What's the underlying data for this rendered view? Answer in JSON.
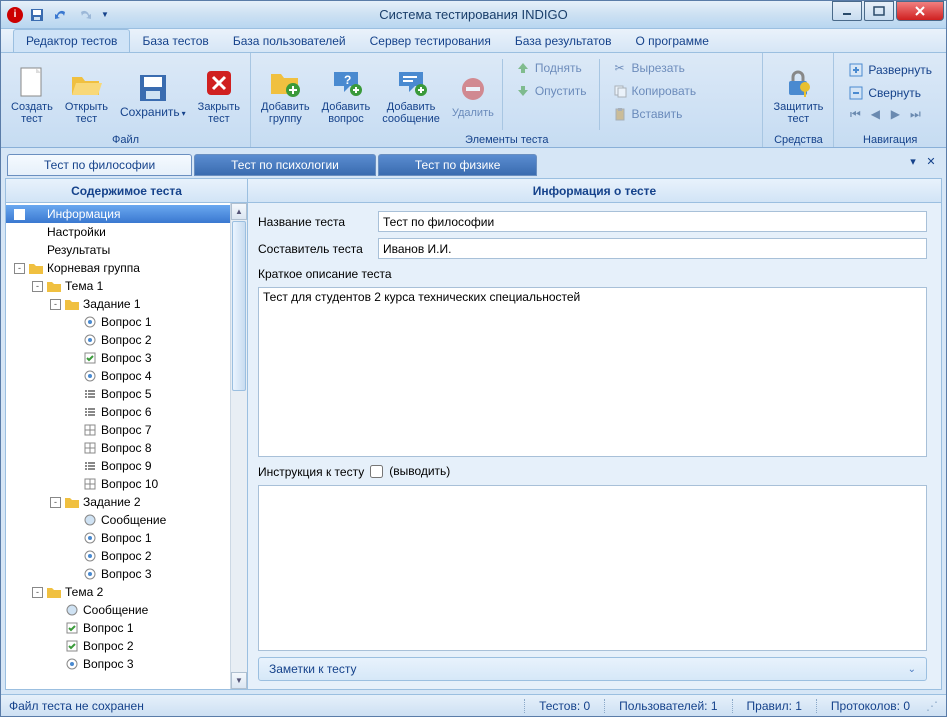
{
  "title": "Система тестирования INDIGO",
  "menu": {
    "items": [
      "Редактор тестов",
      "База тестов",
      "База пользователей",
      "Сервер тестирования",
      "База результатов",
      "О программе"
    ],
    "active": 0
  },
  "ribbon": {
    "file": {
      "label": "Файл",
      "create": "Создать\nтест",
      "open": "Открыть\nтест",
      "save": "Сохранить",
      "close": "Закрыть\nтест"
    },
    "elements": {
      "label": "Элементы теста",
      "addGroup": "Добавить\nгруппу",
      "addQuestion": "Добавить\nвопрос",
      "addMessage": "Добавить\nсообщение",
      "delete": "Удалить",
      "up": "Поднять",
      "down": "Опустить",
      "cut": "Вырезать",
      "copy": "Копировать",
      "paste": "Вставить"
    },
    "tools": {
      "label": "Средства",
      "protect": "Защитить\nтест"
    },
    "nav": {
      "label": "Навигация",
      "expand": "Развернуть",
      "collapse": "Свернуть"
    }
  },
  "docTabs": [
    "Тест по философии",
    "Тест по психологии",
    "Тест по физике"
  ],
  "leftTitle": "Содержимое теста",
  "rightTitle": "Информация о тесте",
  "tree": [
    {
      "lvl": 0,
      "pm": "",
      "icon": "info",
      "label": "Информация",
      "sel": true
    },
    {
      "lvl": 0,
      "pm": "",
      "icon": "info",
      "label": "Настройки"
    },
    {
      "lvl": 0,
      "pm": "",
      "icon": "info",
      "label": "Результаты"
    },
    {
      "lvl": 0,
      "pm": "-",
      "icon": "folder",
      "label": "Корневая группа"
    },
    {
      "lvl": 1,
      "pm": "-",
      "icon": "folder",
      "label": "Тема 1"
    },
    {
      "lvl": 2,
      "pm": "-",
      "icon": "folder",
      "label": "Задание 1"
    },
    {
      "lvl": 3,
      "pm": "",
      "icon": "radio",
      "label": "Вопрос 1"
    },
    {
      "lvl": 3,
      "pm": "",
      "icon": "radio",
      "label": "Вопрос 2"
    },
    {
      "lvl": 3,
      "pm": "",
      "icon": "check",
      "label": "Вопрос 3"
    },
    {
      "lvl": 3,
      "pm": "",
      "icon": "radio",
      "label": "Вопрос 4"
    },
    {
      "lvl": 3,
      "pm": "",
      "icon": "list",
      "label": "Вопрос 5"
    },
    {
      "lvl": 3,
      "pm": "",
      "icon": "list",
      "label": "Вопрос 6"
    },
    {
      "lvl": 3,
      "pm": "",
      "icon": "grid",
      "label": "Вопрос 7"
    },
    {
      "lvl": 3,
      "pm": "",
      "icon": "grid",
      "label": "Вопрос 8"
    },
    {
      "lvl": 3,
      "pm": "",
      "icon": "list",
      "label": "Вопрос 9"
    },
    {
      "lvl": 3,
      "pm": "",
      "icon": "grid",
      "label": "Вопрос 10"
    },
    {
      "lvl": 2,
      "pm": "-",
      "icon": "folder",
      "label": "Задание 2"
    },
    {
      "lvl": 3,
      "pm": "",
      "icon": "msg",
      "label": "Сообщение"
    },
    {
      "lvl": 3,
      "pm": "",
      "icon": "radio",
      "label": "Вопрос 1"
    },
    {
      "lvl": 3,
      "pm": "",
      "icon": "radio",
      "label": "Вопрос 2"
    },
    {
      "lvl": 3,
      "pm": "",
      "icon": "radio",
      "label": "Вопрос 3"
    },
    {
      "lvl": 1,
      "pm": "-",
      "icon": "folder",
      "label": "Тема 2"
    },
    {
      "lvl": 2,
      "pm": "",
      "icon": "msg",
      "label": "Сообщение"
    },
    {
      "lvl": 2,
      "pm": "",
      "icon": "check",
      "label": "Вопрос 1"
    },
    {
      "lvl": 2,
      "pm": "",
      "icon": "check",
      "label": "Вопрос 2"
    },
    {
      "lvl": 2,
      "pm": "",
      "icon": "radio",
      "label": "Вопрос 3"
    }
  ],
  "form": {
    "nameLabel": "Название теста",
    "nameValue": "Тест по философии",
    "authorLabel": "Составитель теста",
    "authorValue": "Иванов И.И.",
    "descLabel": "Краткое описание теста",
    "descValue": "Тест для студентов 2 курса технических специальностей",
    "instrLabel": "Инструкция к тесту",
    "instrChk": "(выводить)",
    "notesLabel": "Заметки к тесту"
  },
  "status": {
    "file": "Файл теста не сохранен",
    "tests": "Тестов: 0",
    "users": "Пользователей: 1",
    "rules": "Правил: 1",
    "protocols": "Протоколов: 0"
  }
}
